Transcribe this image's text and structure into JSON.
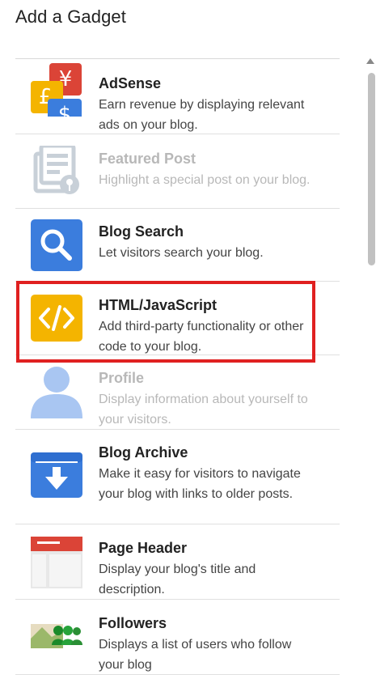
{
  "dialog": {
    "title": "Add a Gadget"
  },
  "gadgets": [
    {
      "name": "AdSense",
      "description": "Earn revenue by displaying relevant ads on your blog.",
      "icon": "adsense-icon",
      "disabled": false
    },
    {
      "name": "Featured Post",
      "description": "Highlight a special post on your blog.",
      "icon": "featured-post-icon",
      "disabled": true
    },
    {
      "name": "Blog Search",
      "description": "Let visitors search your blog.",
      "icon": "search-icon",
      "disabled": false
    },
    {
      "name": "HTML/JavaScript",
      "description": "Add third-party functionality or other code to your blog.",
      "icon": "code-icon",
      "disabled": false,
      "highlighted": true
    },
    {
      "name": "Profile",
      "description": "Display information about yourself to your visitors.",
      "icon": "profile-icon",
      "disabled": true
    },
    {
      "name": "Blog Archive",
      "description": "Make it easy for visitors to navigate your blog with links to older posts.",
      "icon": "archive-icon",
      "disabled": false
    },
    {
      "name": "Page Header",
      "description": "Display your blog's title and description.",
      "icon": "page-header-icon",
      "disabled": false
    },
    {
      "name": "Followers",
      "description": "Displays a list of users who follow your blog",
      "icon": "followers-icon",
      "disabled": false
    }
  ],
  "colors": {
    "highlight_border": "#e02020",
    "blue": "#3b7ddd",
    "yellow": "#f4b400",
    "red": "#db4437"
  }
}
